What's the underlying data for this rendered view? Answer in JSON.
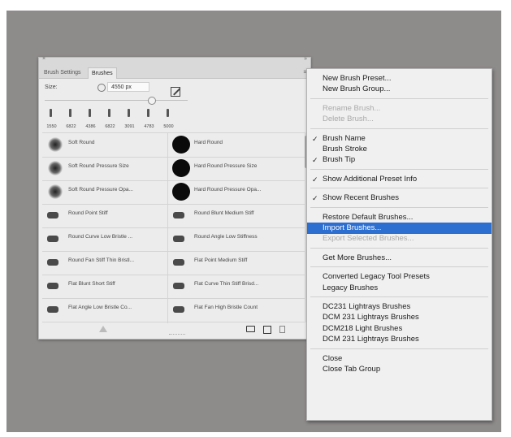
{
  "panel": {
    "close_glyph": "×",
    "collapse_glyph": "»",
    "tabs": [
      "Brush Settings",
      "Brushes"
    ],
    "menu_glyph": "≡",
    "size_label": "Size:",
    "size_value": "4550 px",
    "recent_brushes": [
      "1550",
      "6822",
      "4386",
      "6822",
      "3091",
      "4783",
      "5000"
    ],
    "brushes_left": [
      {
        "name": "Soft Round",
        "thumb": "soft"
      },
      {
        "name": "Soft Round Pressure Size",
        "thumb": "soft"
      },
      {
        "name": "Soft Round Pressure Opa...",
        "thumb": "soft"
      },
      {
        "name": "Round Point Stiff",
        "thumb": "tip"
      },
      {
        "name": "Round Curve Low Bristle ...",
        "thumb": "tip"
      },
      {
        "name": "Round Fan Stiff Thin Bristl...",
        "thumb": "tip"
      },
      {
        "name": "Flat Blunt Short Stiff",
        "thumb": "tip"
      },
      {
        "name": "Flat Angle Low Bristle Co...",
        "thumb": "tip"
      }
    ],
    "brushes_right": [
      {
        "name": "Hard Round",
        "thumb": "hard"
      },
      {
        "name": "Hard Round Pressure Size",
        "thumb": "hard"
      },
      {
        "name": "Hard Round Pressure Opa...",
        "thumb": "hard"
      },
      {
        "name": "Round Blunt Medium Stiff",
        "thumb": "tip"
      },
      {
        "name": "Round Angle Low Stiffness",
        "thumb": "tip"
      },
      {
        "name": "Flat Point Medium Stiff",
        "thumb": "tip"
      },
      {
        "name": "Flat Curve Thin Stiff Brisd...",
        "thumb": "tip"
      },
      {
        "name": "Flat Fan High Bristle Count",
        "thumb": "tip"
      }
    ]
  },
  "menu": {
    "groups": [
      [
        {
          "label": "New Brush Preset...",
          "state": "normal"
        },
        {
          "label": "New Brush Group...",
          "state": "normal"
        }
      ],
      [
        {
          "label": "Rename Brush...",
          "state": "disabled"
        },
        {
          "label": "Delete Brush...",
          "state": "disabled"
        }
      ],
      [
        {
          "label": "Brush Name",
          "state": "checked"
        },
        {
          "label": "Brush Stroke",
          "state": "normal"
        },
        {
          "label": "Brush Tip",
          "state": "checked"
        }
      ],
      [
        {
          "label": "Show Additional Preset Info",
          "state": "checked"
        }
      ],
      [
        {
          "label": "Show Recent Brushes",
          "state": "checked"
        }
      ],
      [
        {
          "label": "Restore Default Brushes...",
          "state": "normal"
        },
        {
          "label": "Import Brushes...",
          "state": "highlighted"
        },
        {
          "label": "Export Selected Brushes...",
          "state": "disabled"
        }
      ],
      [
        {
          "label": "Get More Brushes...",
          "state": "normal"
        }
      ],
      [
        {
          "label": "Converted Legacy Tool Presets",
          "state": "normal"
        },
        {
          "label": "Legacy Brushes",
          "state": "normal"
        }
      ],
      [
        {
          "label": "DC231 Lightrays Brushes",
          "state": "normal"
        },
        {
          "label": "DCM 231 Lightrays Brushes",
          "state": "normal"
        },
        {
          "label": "DCM218 Light Brushes",
          "state": "normal"
        },
        {
          "label": "DCM 231 Lightrays Brushes",
          "state": "normal"
        }
      ],
      [
        {
          "label": "Close",
          "state": "normal"
        },
        {
          "label": "Close Tab Group",
          "state": "normal"
        }
      ]
    ],
    "check_glyph": "✓"
  },
  "colors": {
    "backdrop": "#8e8b8b",
    "highlight": "#2c6fd1"
  }
}
